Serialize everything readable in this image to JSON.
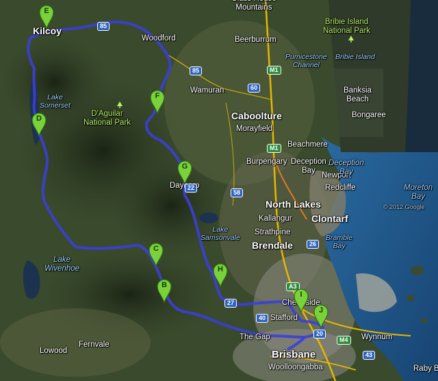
{
  "places": {
    "glasshouse": "Glass House\nMountains",
    "kilcoy": "Kilcoy",
    "woodford": "Woodford",
    "beerburrum": "Beerburrum",
    "wamuran": "Wamuran",
    "caboolture": "Caboolture",
    "morayfield": "Morayfield",
    "beachmere": "Beachmere",
    "burpengary": "Burpengary",
    "dayboro": "Dayboro",
    "deception_bay_town": "Deception\nBay",
    "newport": "Newport",
    "redcliffe": "Redcliffe",
    "north_lakes": "North Lakes",
    "kallangur": "Kallangur",
    "clontarf": "Clontarf",
    "strathpine": "Strathpine",
    "brendale": "Brendale",
    "chermside": "Chermside",
    "stafford": "Stafford",
    "the_gap": "The Gap",
    "brisbane": "Brisbane",
    "woolloongabba": "Woolloongabba",
    "wynnum": "Wynnum",
    "raby_bay": "Raby B",
    "fernvale": "Fernvale",
    "lowood": "Lowood",
    "banksia_beach": "Banksia\nBeach",
    "bongaree": "Bongaree"
  },
  "parks": {
    "daguilar": "D'Aguilar\nNational Park",
    "bribie": "Bribie Island\nNational Park"
  },
  "water": {
    "lake_somerset": "Lake\nSomerset",
    "lake_wivenhoe": "Lake\nWivenhoe",
    "lake_samsonvale": "Lake\nSamsonvale",
    "pumicestone": "Pumicestone\nChannel",
    "bribie_island": "Bribie Island",
    "deception_bay": "Deception\nBay",
    "bramble_bay": "Bramble\nBay",
    "moreton_bay": "Moreton\nBay"
  },
  "roads": {
    "r85a": "85",
    "r85b": "85",
    "m1a": "M1",
    "r60": "60",
    "m1b": "M1",
    "r58": "58",
    "r22": "22",
    "r26": "26",
    "r27": "27",
    "a3": "A3",
    "r40": "40",
    "m4": "M4",
    "r43": "43",
    "r20": "20"
  },
  "markers": [
    "B",
    "C",
    "D",
    "E",
    "F",
    "G",
    "H",
    "I",
    "J"
  ],
  "colors": {
    "route": "#3b3fd9",
    "marker": "#7ad13a",
    "road_yellow": "#e6b800",
    "road_orange": "#e07a1f",
    "sea": "#1d4f80"
  },
  "watermark": "© 2012 Google"
}
